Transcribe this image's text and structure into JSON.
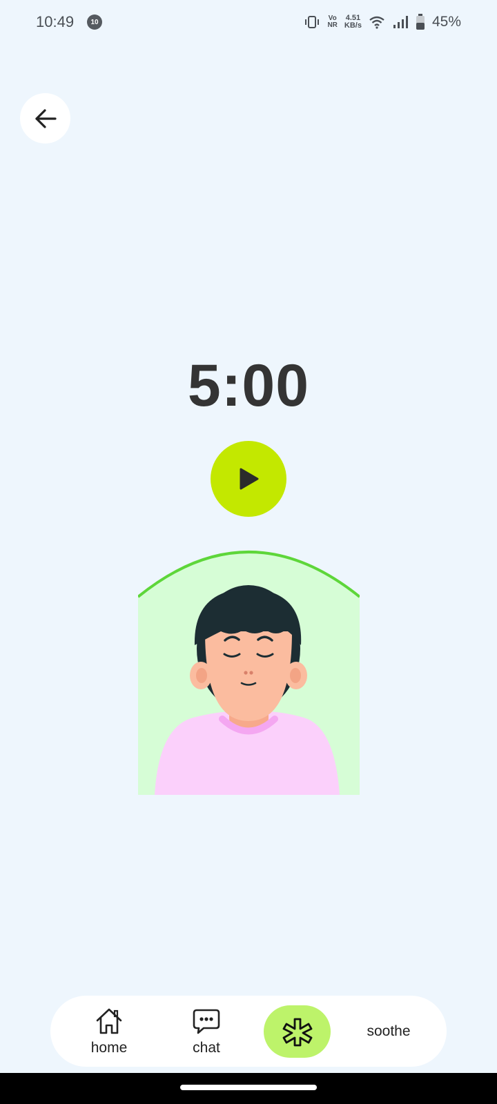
{
  "status_bar": {
    "time": "10:49",
    "notification_badge": "10",
    "vonr_top": "Vo",
    "vonr_bottom": "NR",
    "net_speed_value": "4.51",
    "net_speed_unit": "KB/s",
    "battery_percent": "45%",
    "icons": [
      "vibrate-icon",
      "wifi-icon",
      "signal-icon",
      "battery-icon"
    ]
  },
  "header": {
    "back_icon": "arrow-left-icon"
  },
  "timer": {
    "display": "5:00",
    "play_icon": "play-icon",
    "play_color": "#c3e800"
  },
  "illustration": {
    "subject": "meditating-person",
    "background_color": "#d6fdd6",
    "outline_color": "#5ed63a"
  },
  "bottom_nav": {
    "items": [
      {
        "label": "home",
        "icon": "house-icon",
        "active": false
      },
      {
        "label": "chat",
        "icon": "chat-bubble-icon",
        "active": false
      },
      {
        "label": "",
        "icon": "asterisk-icon",
        "active": true
      },
      {
        "label": "soothe",
        "icon": "",
        "active": false
      }
    ],
    "active_color": "#bdf36a"
  }
}
